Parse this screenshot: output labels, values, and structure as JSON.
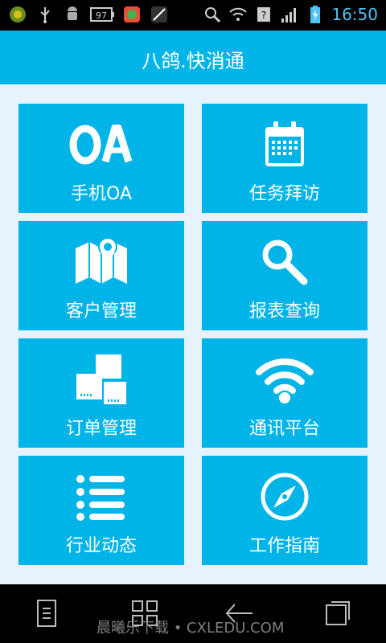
{
  "status_bar": {
    "battery_percent_label": "97",
    "time": "16:50",
    "icons": [
      "usb-icon",
      "android-icon",
      "battery-icon",
      "app-icon",
      "leaf-icon",
      "search-icon",
      "wifi-icon",
      "signal-icon",
      "charging-icon"
    ]
  },
  "header": {
    "title": "八鸽.快消通"
  },
  "tiles": [
    {
      "label": "手机OA",
      "icon": "oa-icon"
    },
    {
      "label": "任务拜访",
      "icon": "calendar-icon"
    },
    {
      "label": "客户管理",
      "icon": "map-pin-icon"
    },
    {
      "label": "报表查询",
      "icon": "search-icon"
    },
    {
      "label": "订单管理",
      "icon": "boxes-icon"
    },
    {
      "label": "通讯平台",
      "icon": "wifi-icon"
    },
    {
      "label": "行业动态",
      "icon": "list-icon"
    },
    {
      "label": "工作指南",
      "icon": "compass-icon"
    }
  ],
  "colors": {
    "accent": "#00b4e8",
    "background": "#e6f3fa"
  },
  "watermark": "晨曦乐下载 • CXLEDU.COM"
}
